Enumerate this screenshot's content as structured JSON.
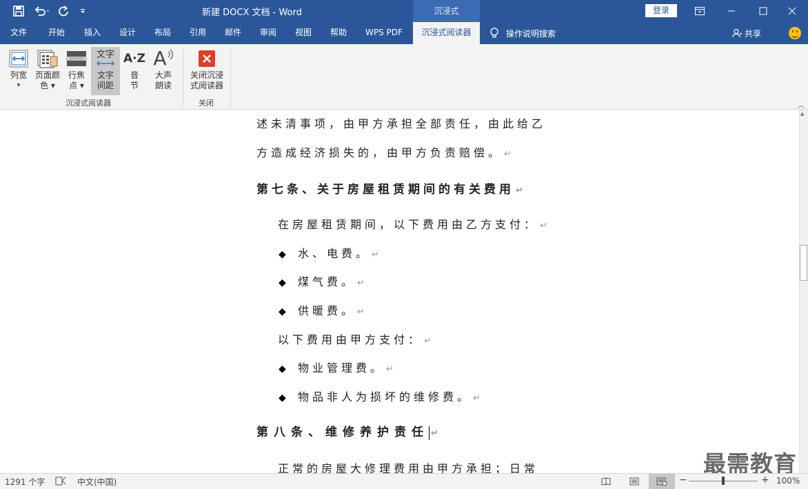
{
  "window": {
    "doc_title": "新建 DOCX 文档  -  Word",
    "context_tab": "沉浸式",
    "login": "登录"
  },
  "menu": {
    "tabs": [
      "文件",
      "开始",
      "插入",
      "设计",
      "布局",
      "引用",
      "邮件",
      "审阅",
      "视图",
      "帮助",
      "WPS PDF",
      "沉浸式阅读器"
    ],
    "active_tab": "沉浸式阅读器",
    "tell_me": "操作说明搜索",
    "share": "共享"
  },
  "ribbon": {
    "buttons": [
      {
        "label1": "列宽",
        "label2": "▾",
        "icon": "column-width-icon"
      },
      {
        "label1": "页面颜",
        "label2": "色 ▾",
        "icon": "page-color-icon"
      },
      {
        "label1": "行焦",
        "label2": "点 ▾",
        "icon": "line-focus-icon"
      },
      {
        "label1": "文字",
        "label2": "间距",
        "icon": "text-spacing-icon",
        "icon_text": "文字"
      },
      {
        "label1": "音",
        "label2": "节",
        "icon": "syllables-icon",
        "icon_text": "A·Z"
      },
      {
        "label1": "大声",
        "label2": "朗读",
        "icon": "read-aloud-icon",
        "icon_text": "A"
      },
      {
        "label1": "关闭沉浸",
        "label2": "式阅读器",
        "icon": "close-reader-icon"
      }
    ],
    "groups": [
      "沉浸式阅读器",
      "关闭"
    ]
  },
  "document": {
    "lines": [
      {
        "text": "述未清事项，由甲方承担全部责任，由此给乙",
        "mark": ""
      },
      {
        "text": "方造成经济损失的，由甲方负责赔偿。",
        "mark": "↵"
      },
      {
        "text": "第七条、关于房屋租赁期间的有关费用",
        "mark": "↵"
      },
      {
        "text": "在房屋租赁期间，以下费用由乙方支付：",
        "mark": "↵"
      },
      {
        "bullet": "◆",
        "text": "水、电费。",
        "mark": "↵"
      },
      {
        "bullet": "◆",
        "text": "煤气费。",
        "mark": "↵"
      },
      {
        "bullet": "◆",
        "text": "供暖费。",
        "mark": "↵"
      },
      {
        "text": "以下费用由甲方支付：",
        "mark": "↵"
      },
      {
        "bullet": "◆",
        "text": "物业管理费。",
        "mark": "↵"
      },
      {
        "bullet": "◆",
        "text": "物品非人为损坏的维修费。",
        "mark": "↵"
      },
      {
        "text": "第八条、维修养护责任",
        "mark": "↵"
      },
      {
        "text": "正常的房屋大修理费用由甲方承担；日常",
        "mark": ""
      }
    ]
  },
  "watermark": "最需教育",
  "status": {
    "word_count": "1291 个字",
    "language": "中文(中国)",
    "zoom_minus": "−",
    "zoom_plus": "+",
    "zoom": "100%"
  },
  "colors": {
    "accent": "#2b579a",
    "ribbon_bg": "#f3f3f3",
    "close_red": "#d9412b"
  }
}
